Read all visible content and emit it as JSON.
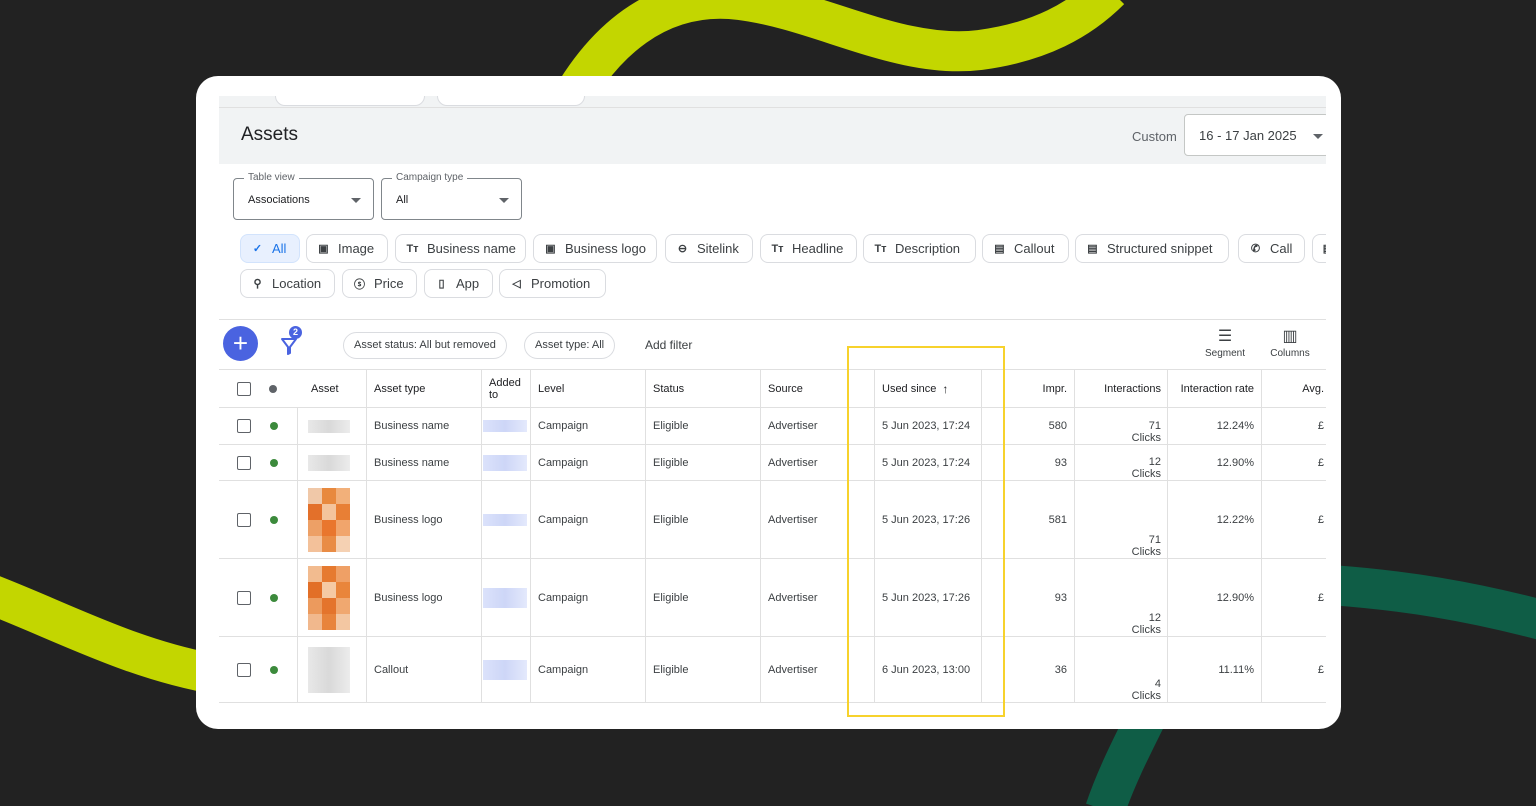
{
  "page": {
    "title": "Assets",
    "date_range_label": "Custom",
    "date_range_value": "16 - 17 Jan 2025"
  },
  "dropdowns": {
    "table_view": {
      "legend": "Table view",
      "value": "Associations"
    },
    "campaign_type": {
      "legend": "Campaign type",
      "value": "All"
    }
  },
  "chips": [
    {
      "label": "All",
      "icon": "check-icon",
      "selected": true
    },
    {
      "label": "Image",
      "icon": "image-icon"
    },
    {
      "label": "Business name",
      "icon": "text-icon"
    },
    {
      "label": "Business logo",
      "icon": "image-icon"
    },
    {
      "label": "Sitelink",
      "icon": "link-icon"
    },
    {
      "label": "Headline",
      "icon": "text-icon"
    },
    {
      "label": "Description",
      "icon": "text-icon"
    },
    {
      "label": "Callout",
      "icon": "document-icon"
    },
    {
      "label": "Structured snippet",
      "icon": "document-icon"
    },
    {
      "label": "Call",
      "icon": "phone-icon"
    },
    {
      "label": "Location",
      "icon": "location-pin-icon"
    },
    {
      "label": "Price",
      "icon": "price-icon"
    },
    {
      "label": "App",
      "icon": "mobile-icon"
    },
    {
      "label": "Promotion",
      "icon": "megaphone-icon"
    }
  ],
  "toolbar": {
    "filter_count": "2",
    "filter_chips": [
      "Asset status: All but removed",
      "Asset type: All"
    ],
    "add_filter": "Add filter",
    "segment": "Segment",
    "columns": "Columns"
  },
  "table": {
    "headers": {
      "asset": "Asset",
      "asset_type": "Asset type",
      "added_to": "Added to",
      "level": "Level",
      "status": "Status",
      "source": "Source",
      "used_since": "Used since",
      "impr": "Impr.",
      "interactions": "Interactions",
      "interaction_rate": "Interaction rate",
      "avg": "Avg."
    },
    "rows": [
      {
        "asset_type": "Business name",
        "level": "Campaign",
        "status": "Eligible",
        "source": "Advertiser",
        "used_since": "5 Jun 2023, 17:24",
        "impr": "580",
        "interactions": "71",
        "interactions_unit": "Clicks",
        "interaction_rate": "12.24%",
        "avg": "£"
      },
      {
        "asset_type": "Business name",
        "level": "Campaign",
        "status": "Eligible",
        "source": "Advertiser",
        "used_since": "5 Jun 2023, 17:24",
        "impr": "93",
        "interactions": "12",
        "interactions_unit": "Clicks",
        "interaction_rate": "12.90%",
        "avg": "£"
      },
      {
        "asset_type": "Business logo",
        "level": "Campaign",
        "status": "Eligible",
        "source": "Advertiser",
        "used_since": "5 Jun 2023, 17:26",
        "impr": "581",
        "interactions": "71",
        "interactions_unit": "Clicks",
        "interaction_rate": "12.22%",
        "avg": "£"
      },
      {
        "asset_type": "Business logo",
        "level": "Campaign",
        "status": "Eligible",
        "source": "Advertiser",
        "used_since": "5 Jun 2023, 17:26",
        "impr": "93",
        "interactions": "12",
        "interactions_unit": "Clicks",
        "interaction_rate": "12.90%",
        "avg": "£"
      },
      {
        "asset_type": "Callout",
        "level": "Campaign",
        "status": "Eligible",
        "source": "Advertiser",
        "used_since": "6 Jun 2023, 13:00",
        "impr": "36",
        "interactions": "4",
        "interactions_unit": "Clicks",
        "interaction_rate": "11.11%",
        "avg": "£"
      }
    ]
  },
  "colors": {
    "background": "#222222",
    "accent_lime": "#c3d600",
    "accent_green": "#0f5d46",
    "highlight": "#f7d22c",
    "primary_blue": "#4a63e0",
    "status_green": "#3c8a3c"
  }
}
